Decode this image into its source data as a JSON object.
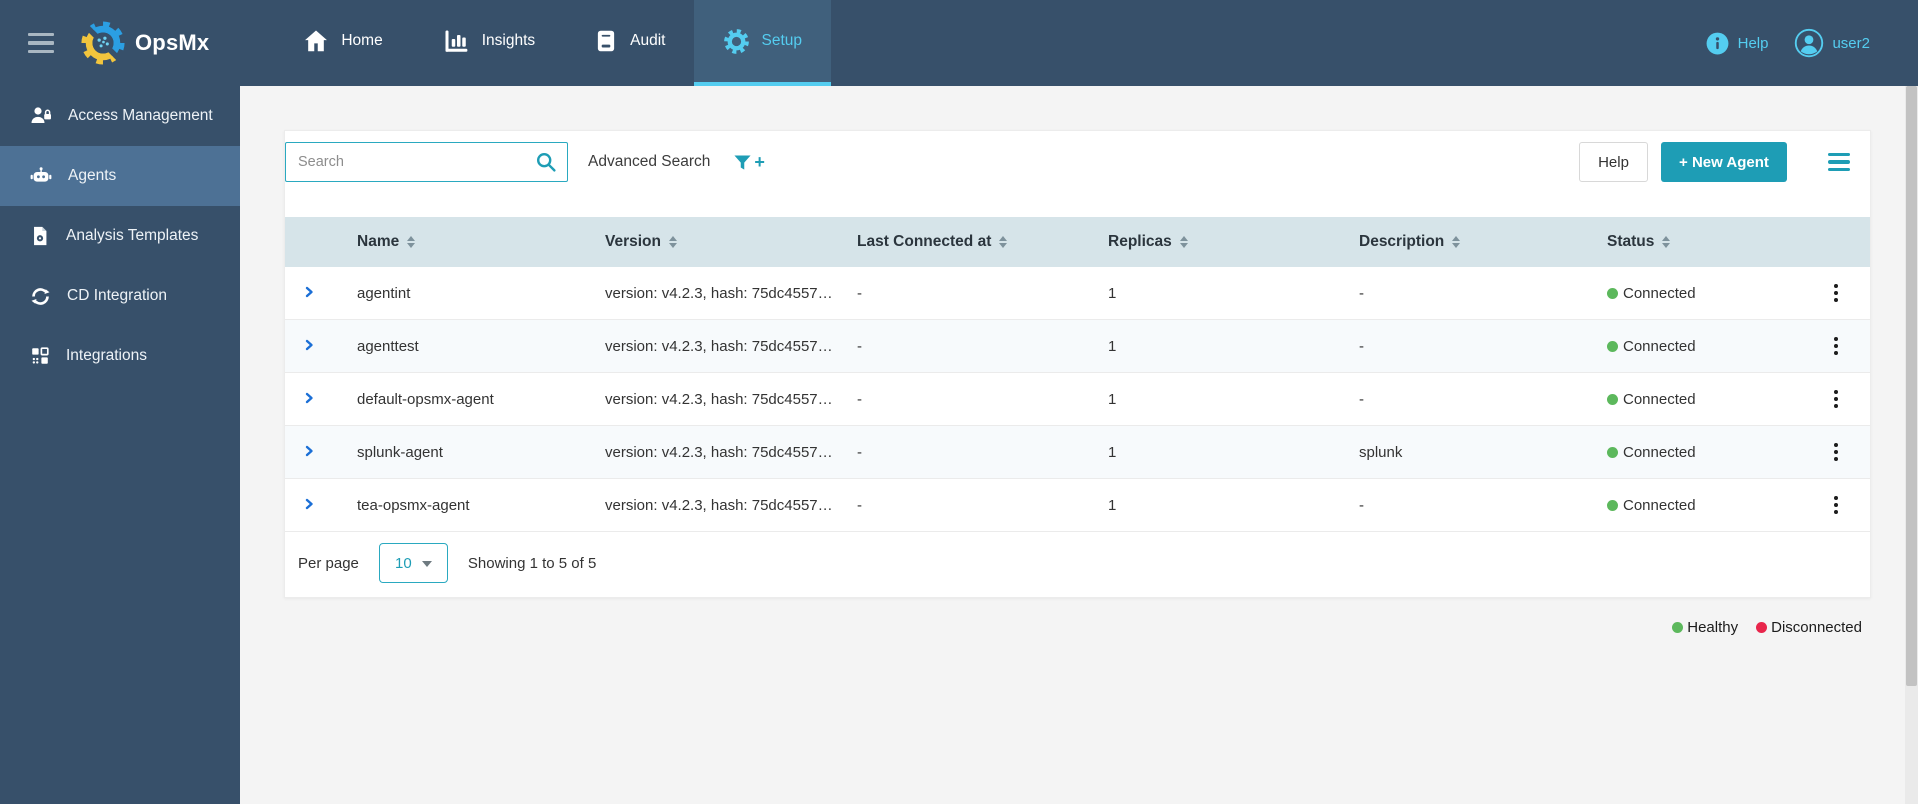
{
  "brand": {
    "name": "OpsMx"
  },
  "navbar": {
    "tabs": [
      {
        "label": "Home"
      },
      {
        "label": "Insights"
      },
      {
        "label": "Audit"
      },
      {
        "label": "Setup",
        "active": true
      }
    ],
    "help": "Help",
    "user": "user2"
  },
  "sidebar": {
    "items": [
      {
        "label": "Access Management"
      },
      {
        "label": "Agents",
        "active": true
      },
      {
        "label": "Analysis Templates"
      },
      {
        "label": "CD Integration"
      },
      {
        "label": "Integrations"
      }
    ]
  },
  "toolbar": {
    "search_placeholder": "Search",
    "advanced_search": "Advanced Search",
    "filter_plus": "+",
    "help_button": "Help",
    "new_agent_button": "+ New Agent"
  },
  "table": {
    "columns": [
      "Name",
      "Version",
      "Last Connected at",
      "Replicas",
      "Description",
      "Status"
    ],
    "rows": [
      {
        "name": "agentint",
        "version": "version: v4.2.3, hash: 75dc4557…",
        "last_connected": "-",
        "replicas": "1",
        "description": "-",
        "status": "Connected"
      },
      {
        "name": "agenttest",
        "version": "version: v4.2.3, hash: 75dc4557…",
        "last_connected": "-",
        "replicas": "1",
        "description": "-",
        "status": "Connected"
      },
      {
        "name": "default-opsmx-agent",
        "version": "version: v4.2.3, hash: 75dc4557…",
        "last_connected": "-",
        "replicas": "1",
        "description": "-",
        "status": "Connected"
      },
      {
        "name": "splunk-agent",
        "version": "version: v4.2.3, hash: 75dc4557…",
        "last_connected": "-",
        "replicas": "1",
        "description": "splunk",
        "status": "Connected"
      },
      {
        "name": "tea-opsmx-agent",
        "version": "version: v4.2.3, hash: 75dc4557…",
        "last_connected": "-",
        "replicas": "1",
        "description": "-",
        "status": "Connected"
      }
    ]
  },
  "pagination": {
    "per_page_label": "Per page",
    "per_page_value": "10",
    "showing": "Showing 1 to 5 of 5"
  },
  "legend": [
    {
      "label": "Healthy",
      "color": "#5cb85c"
    },
    {
      "label": "Disconnected",
      "color": "#e8254b"
    }
  ],
  "colors": {
    "navbar": "#37506a",
    "sidebar_active": "#4d7195",
    "accent_cyan": "#54cdf0",
    "accent_teal": "#1e9db5",
    "table_header": "#d6e4e9",
    "status_healthy": "#5cb85c",
    "status_disconnected": "#e8254b"
  }
}
